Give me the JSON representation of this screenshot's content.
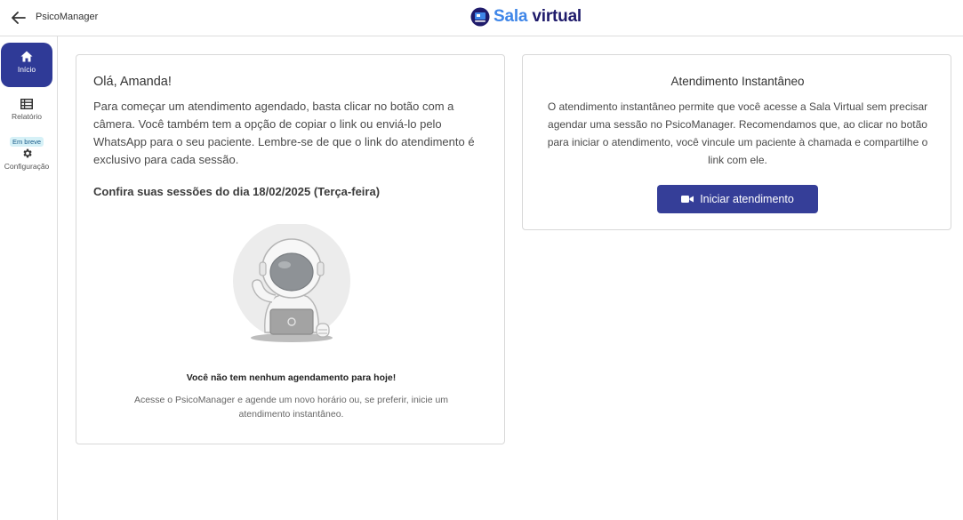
{
  "header": {
    "app_name": "PsicoManager",
    "brand_part1": "Sala",
    "brand_part2": "virtual"
  },
  "sidebar": {
    "items": [
      {
        "label": "Início",
        "icon": "home-icon",
        "active": true
      },
      {
        "label": "Relatório",
        "icon": "table-icon",
        "active": false
      },
      {
        "label": "Configuração",
        "icon": "gear-icon",
        "badge": "Em breve",
        "active": false
      }
    ]
  },
  "left_card": {
    "greeting": "Olá, Amanda!",
    "intro": "Para começar um atendimento agendado, basta clicar no botão com a câmera. Você também tem a opção de copiar o link ou enviá-lo pelo WhatsApp para o seu paciente. Lembre-se de que o link do atendimento é exclusivo para cada sessão.",
    "sessions_title": "Confira suas sessões do dia 18/02/2025 (Terça-feira)",
    "empty_title": "Você não tem nenhum agendamento para hoje!",
    "empty_desc": "Acesse o PsicoManager e agende um novo horário ou, se preferir, inicie um atendimento instantâneo."
  },
  "right_card": {
    "title": "Atendimento Instantâneo",
    "description": "O atendimento instantâneo permite que você acesse a Sala Virtual sem precisar agendar uma sessão no PsicoManager. Recomendamos que, ao clicar no botão para iniciar o atendimento, você vincule um paciente à chamada e compartilhe o link com ele.",
    "button_label": "Iniciar atendimento",
    "button_icon": "video-camera-icon"
  },
  "colors": {
    "primary": "#353e98",
    "brand_light": "#3f86e8",
    "brand_dark": "#1f1b6b",
    "badge_bg": "#d6f1f7"
  }
}
